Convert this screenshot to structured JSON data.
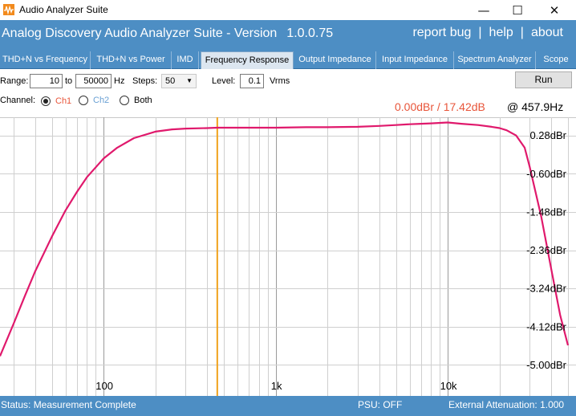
{
  "window": {
    "title": "Audio Analyzer Suite",
    "minimize_glyph": "—",
    "maximize_glyph": "☐",
    "close_glyph": "✕"
  },
  "header": {
    "app_name": "Analog Discovery Audio Analyzer Suite - Version",
    "version": "1.0.0.75",
    "links": [
      "report bug",
      "help",
      "about"
    ],
    "separator": "|"
  },
  "tabs": [
    {
      "label": "THD+N vs Frequency",
      "active": false
    },
    {
      "label": "THD+N vs Power",
      "active": false
    },
    {
      "label": "IMD",
      "active": false
    },
    {
      "label": "Frequency Response",
      "active": true
    },
    {
      "label": "Output Impedance",
      "active": false
    },
    {
      "label": "Input Impedance",
      "active": false
    },
    {
      "label": "Spectrum Analyzer",
      "active": false
    },
    {
      "label": "Scope",
      "active": false
    }
  ],
  "controls": {
    "range_label": "Range:",
    "range_from": "10",
    "to_label": "to",
    "range_to": "50000",
    "hz_label": "Hz",
    "steps_label": "Steps:",
    "steps_value": "50",
    "level_label": "Level:",
    "level_value": "0.1",
    "vrms_label": "Vrms",
    "run_label": "Run",
    "channel_label": "Channel:",
    "channels": [
      {
        "label": "Ch1",
        "selected": true
      },
      {
        "label": "Ch2",
        "selected": false
      },
      {
        "label": "Both",
        "selected": false
      }
    ]
  },
  "readout": {
    "level": "0.00dBr / 17.42dB",
    "frequency": "@ 457.9Hz"
  },
  "colors": {
    "accent_blue": "#4d8ec4",
    "ch1": "#e8553a",
    "ch2": "#6aa0d4",
    "trace": "#e0196c",
    "cursor": "#f0a21c",
    "readout": "#e8553a"
  },
  "chart_data": {
    "type": "line",
    "x_scale": "log",
    "x_range": [
      25,
      50000
    ],
    "y_range": [
      -5.4,
      0.7
    ],
    "grid": true,
    "x_tick_labels": [
      {
        "value": 100,
        "label": "100"
      },
      {
        "value": 1000,
        "label": "1k"
      },
      {
        "value": 10000,
        "label": "10k"
      }
    ],
    "y_tick_labels": [
      {
        "value": 0.28,
        "label": "0.28dBr"
      },
      {
        "value": -0.6,
        "label": "-0.60dBr"
      },
      {
        "value": -1.48,
        "label": "-1.48dBr"
      },
      {
        "value": -2.36,
        "label": "-2.36dBr"
      },
      {
        "value": -3.24,
        "label": "-3.24dBr"
      },
      {
        "value": -4.12,
        "label": "-4.12dBr"
      },
      {
        "value": -5.0,
        "label": "-5.00dBr"
      }
    ],
    "cursor_x": 457.9,
    "series": [
      {
        "x": [
          25,
          30,
          35,
          40,
          50,
          60,
          70,
          80,
          100,
          120,
          150,
          200,
          250,
          300,
          400,
          458,
          600,
          800,
          1000,
          1500,
          2000,
          3000,
          4000,
          5000,
          6000,
          7000,
          8000,
          10000,
          12000,
          15000,
          18000,
          20000,
          22000,
          25000,
          28000,
          30000,
          35000,
          40000,
          45000,
          50000
        ],
        "y": [
          -4.8,
          -4.05,
          -3.4,
          -2.85,
          -2.05,
          -1.45,
          -1.02,
          -0.68,
          -0.25,
          0.0,
          0.22,
          0.37,
          0.42,
          0.44,
          0.45,
          0.46,
          0.46,
          0.46,
          0.46,
          0.47,
          0.47,
          0.48,
          0.5,
          0.52,
          0.54,
          0.55,
          0.56,
          0.58,
          0.55,
          0.52,
          0.48,
          0.45,
          0.4,
          0.28,
          0.0,
          -0.45,
          -1.6,
          -2.8,
          -3.85,
          -4.55
        ]
      }
    ]
  },
  "status": {
    "text": "Status: Measurement Complete",
    "psu": "PSU: OFF",
    "attenuation": "External Attenuation: 1.000"
  }
}
